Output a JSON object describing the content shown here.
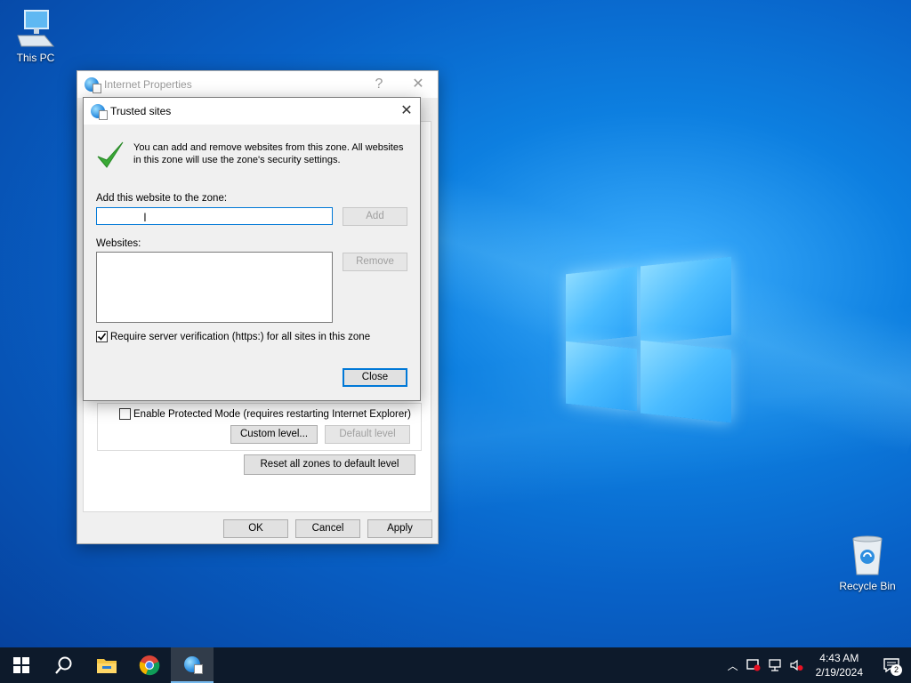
{
  "desktop": {
    "icons": [
      {
        "label": "This PC",
        "icon": "computer-icon"
      },
      {
        "label": "Recycle Bin",
        "icon": "recycle-bin-icon"
      }
    ]
  },
  "internet_properties": {
    "title": "Internet Properties",
    "help_glyph": "?",
    "close_glyph": "✕",
    "protected_mode_label": "Enable Protected Mode (requires restarting Internet Explorer)",
    "protected_mode_checked": false,
    "custom_level_label": "Custom level...",
    "default_level_label": "Default level",
    "reset_all_label": "Reset all zones to default level",
    "ok_label": "OK",
    "cancel_label": "Cancel",
    "apply_label": "Apply"
  },
  "trusted_sites": {
    "title": "Trusted sites",
    "close_glyph": "✕",
    "info_text": "You can add and remove websites from this zone. All websites in this zone will use the zone's security settings.",
    "add_website_label": "Add this website to the zone:",
    "add_website_value": "",
    "add_label": "Add",
    "websites_label": "Websites:",
    "websites": [],
    "remove_label": "Remove",
    "require_https_label": "Require server verification (https:) for all sites in this zone",
    "require_https_checked": true,
    "close_label": "Close"
  },
  "taskbar": {
    "items": [
      "start-icon",
      "search-icon",
      "file-explorer-icon",
      "chrome-icon",
      "internet-options-icon"
    ],
    "time": "4:43 AM",
    "date": "2/19/2024",
    "notification_count": "2"
  }
}
